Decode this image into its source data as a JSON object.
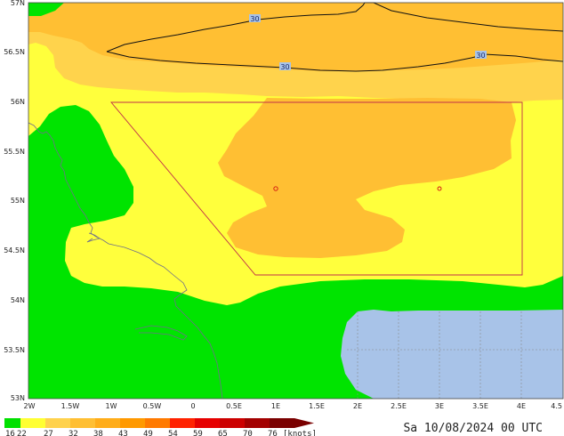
{
  "lat_labels": [
    "57N",
    "56.5N",
    "56N",
    "55.5N",
    "55N",
    "54.5N",
    "54N",
    "53.5N",
    "53N"
  ],
  "lon_labels": [
    "2W",
    "1.5W",
    "1W",
    "0.5W",
    "0",
    "0.5E",
    "1E",
    "1.5E",
    "2E",
    "2.5E",
    "3E",
    "3.5E",
    "4E",
    "4.5"
  ],
  "contour_labels": [
    "30",
    "30",
    "30"
  ],
  "legend": {
    "values": [
      "16",
      "22",
      "27",
      "32",
      "38",
      "43",
      "49",
      "54",
      "59",
      "65",
      "70",
      "76"
    ],
    "unit": "[knots]",
    "colors": [
      "#00e000",
      "#ffff33",
      "#ffd24d",
      "#ffbf33",
      "#ffad1a",
      "#ff9900",
      "#ff7a00",
      "#ff2200",
      "#e60000",
      "#cc0000",
      "#a30000",
      "#7a0000"
    ]
  },
  "valid_time": "Sa 10/08/2024 00 UTC",
  "colors": {
    "green": "#00e400",
    "yellow": "#ffff3c",
    "light_orange": "#ffd34c",
    "orange": "#ffbf33",
    "blue": "#a8c3e8",
    "domain_box": "#c0304a"
  }
}
